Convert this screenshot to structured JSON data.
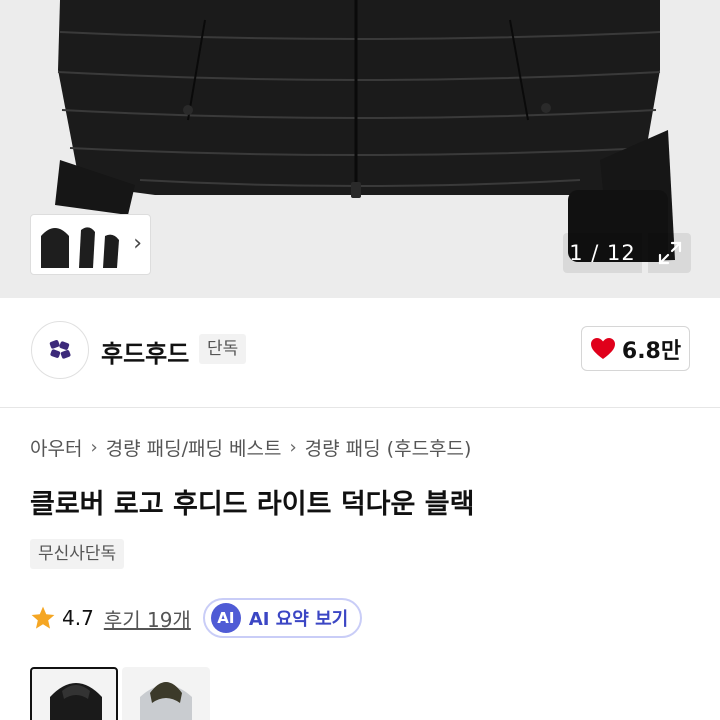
{
  "gallery": {
    "counter": "1 / 12",
    "thumbnail_icon": "chevron-right-icon",
    "expand_icon": "expand-arrows-icon"
  },
  "brand": {
    "name": "후드후드",
    "badge": "단독",
    "logo_icon": "brand-logo-icon",
    "like_count": "6.8만",
    "like_icon": "heart-icon",
    "heart_color": "#e0001b"
  },
  "product": {
    "breadcrumb": [
      "아우터",
      "경량 패딩/패딩 베스트",
      "경량 패딩 (후드후드)"
    ],
    "title": "클로버 로고 후디드 라이트 덕다운 블랙",
    "exclusive_badge": "무신사단독",
    "rating": "4.7",
    "review_link": "후기 19개",
    "ai_button_icon": "AI",
    "ai_button_label": "AI 요약 보기",
    "star_color": "#f5a623",
    "ai_color": "#4f5bd5"
  },
  "colors": {
    "options": [
      "black",
      "light-gray-olive"
    ]
  }
}
